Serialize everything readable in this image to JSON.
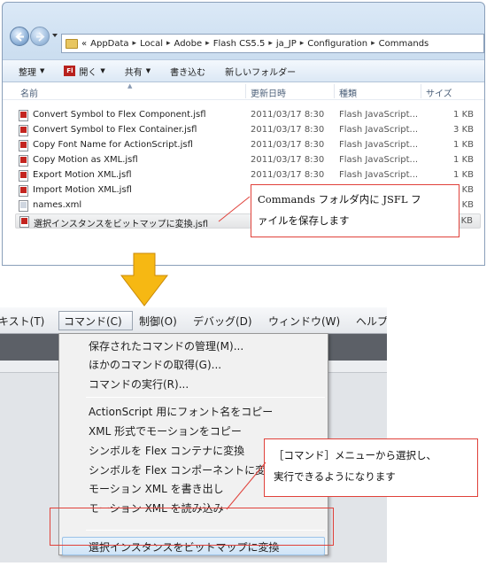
{
  "explorer": {
    "breadcrumb_prefix": "«",
    "path": [
      "AppData",
      "Local",
      "Adobe",
      "Flash CS5.5",
      "ja_JP",
      "Configuration",
      "Commands"
    ],
    "path_separator": "▸",
    "toolbar": {
      "organize": "整理",
      "open": "開く",
      "share": "共有",
      "burn": "書き込む",
      "new_folder": "新しいフォルダー"
    },
    "columns": {
      "name": "名前",
      "date": "更新日時",
      "type": "種類",
      "size": "サイズ"
    },
    "files": [
      {
        "name": "Convert Symbol to Flex Component.jsfl",
        "date": "2011/03/17 8:30",
        "type": "Flash JavaScript...",
        "size": "1 KB"
      },
      {
        "name": "Convert Symbol to Flex Container.jsfl",
        "date": "2011/03/17 8:30",
        "type": "Flash JavaScript...",
        "size": "3 KB"
      },
      {
        "name": "Copy Font Name for ActionScript.jsfl",
        "date": "2011/03/17 8:30",
        "type": "Flash JavaScript...",
        "size": "1 KB"
      },
      {
        "name": "Copy Motion as XML.jsfl",
        "date": "2011/03/17 8:30",
        "type": "Flash JavaScript...",
        "size": "1 KB"
      },
      {
        "name": "Export Motion XML.jsfl",
        "date": "2011/03/17 8:30",
        "type": "Flash JavaScript...",
        "size": "1 KB"
      },
      {
        "name": "Import Motion XML.jsfl",
        "date": "",
        "type": "",
        "size": "KB"
      },
      {
        "name": "names.xml",
        "date": "",
        "type": "",
        "size": "KB"
      },
      {
        "name": "選択インスタンスをビットマップに変換.jsfl",
        "date": "",
        "type": "",
        "size": "KB"
      }
    ]
  },
  "callout_top": {
    "line1": "Commands フォルダ内に JSFL フ",
    "line2": "ァイルを保存します"
  },
  "flash": {
    "menubar": [
      "キスト(T)",
      "コマンド(C)",
      "制御(O)",
      "デバッグ(D)",
      "ウィンドウ(W)",
      "ヘルプ"
    ],
    "menu_items": {
      "manage": "保存されたコマンドの管理(M)...",
      "get_more": "ほかのコマンドの取得(G)...",
      "run": "コマンドの実行(R)...",
      "copy_font": "ActionScript 用にフォント名をコピー",
      "copy_motion": "XML 形式でモーションをコピー",
      "to_container": "シンボルを Flex コンテナに変換",
      "to_component": "シンボルを Flex コンポーネントに変",
      "export_motion": "モーション XML を書き出し",
      "import_motion": "モーション XML を読み込み",
      "to_bitmap": "選択インスタンスをビットマップに変換"
    }
  },
  "callout_bottom": {
    "line1": "［コマンド］メニューから選択し、",
    "line2": "実行できるようになります"
  },
  "colors": {
    "accent_red": "#e0413a",
    "arrow_yellow": "#f6b813",
    "highlight_blue": "#cfe4f7"
  }
}
